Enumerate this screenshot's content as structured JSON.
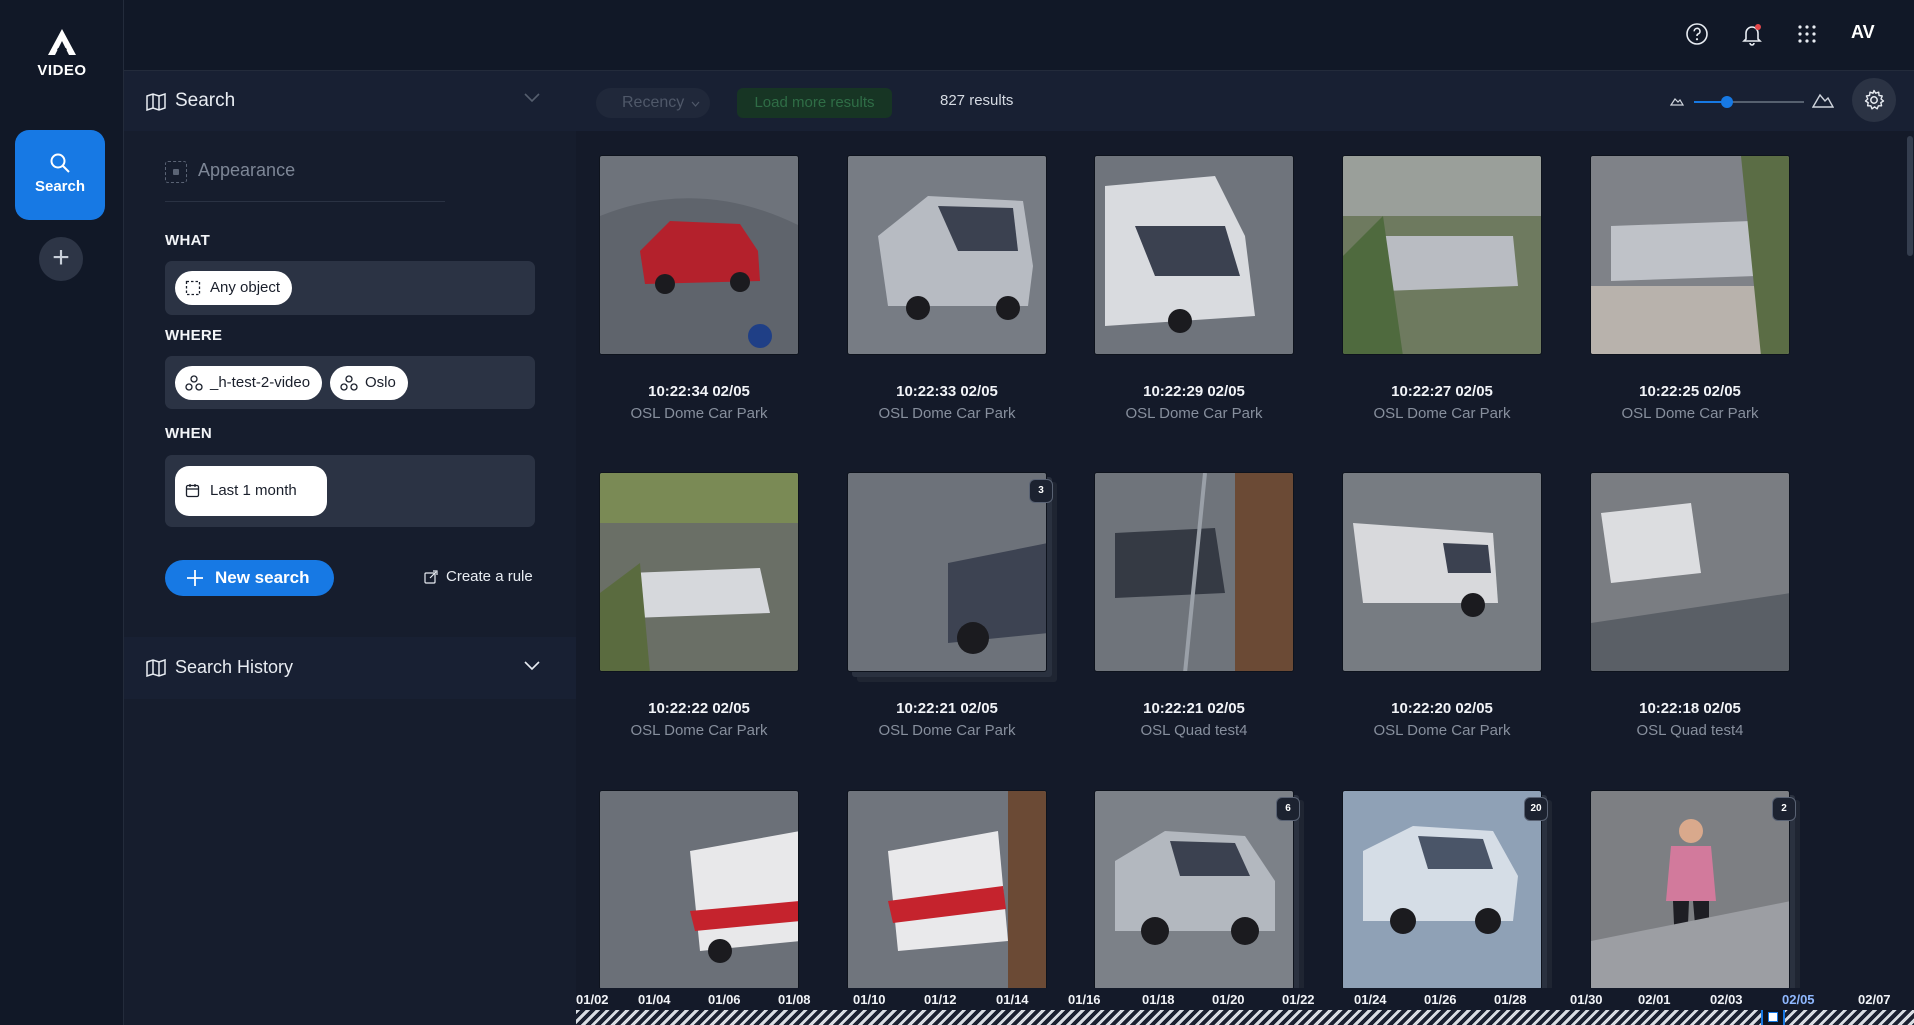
{
  "app": {
    "logo_letter": "A",
    "logo_text": "VIDEO",
    "nav_search_label": "Search",
    "user_initials": "AV"
  },
  "topbar": {
    "icons": [
      "help-icon",
      "bell-icon",
      "apps-grid-icon"
    ],
    "notification_dot_color": "#e2474b"
  },
  "panel": {
    "title": "Search",
    "appearance_label": "Appearance",
    "what_label": "WHAT",
    "what_chip": "Any object",
    "where_label": "WHERE",
    "where_chips": [
      "_h-test-2-video",
      "Oslo"
    ],
    "when_label": "WHEN",
    "when_chip": "Last 1 month",
    "new_search": "New search",
    "create_rule": "Create a rule",
    "history_title": "Search History"
  },
  "toolbar": {
    "sort_label": "Recency",
    "load_more": "Load more results",
    "results_count": "827 results",
    "zoom_level": 0.3
  },
  "colors": {
    "accent": "#1779e4",
    "background": "#141a29",
    "panel": "#161d2d"
  },
  "results": [
    {
      "time": "10:22:34 02/05",
      "camera": "OSL Dome Car Park",
      "badge": "",
      "thumb": "red-car"
    },
    {
      "time": "10:22:33 02/05",
      "camera": "OSL Dome Car Park",
      "badge": "",
      "thumb": "silver-van"
    },
    {
      "time": "10:22:29 02/05",
      "camera": "OSL Dome Car Park",
      "badge": "",
      "thumb": "white-van"
    },
    {
      "time": "10:22:27 02/05",
      "camera": "OSL Dome Car Park",
      "badge": "",
      "thumb": "van-trees"
    },
    {
      "time": "10:22:25 02/05",
      "camera": "OSL Dome Car Park",
      "badge": "",
      "thumb": "van-snow"
    },
    {
      "time": "10:22:22 02/05",
      "camera": "OSL Dome Car Park",
      "badge": "",
      "thumb": "white-van-grass"
    },
    {
      "time": "10:22:21 02/05",
      "camera": "OSL Dome Car Park",
      "badge": "3",
      "thumb": "dark-car-blur"
    },
    {
      "time": "10:22:21 02/05",
      "camera": "OSL Quad test4",
      "badge": "",
      "thumb": "dark-car-pole"
    },
    {
      "time": "10:22:20 02/05",
      "camera": "OSL Dome Car Park",
      "badge": "",
      "thumb": "white-van-road"
    },
    {
      "time": "10:22:18 02/05",
      "camera": "OSL Quad test4",
      "badge": "",
      "thumb": "white-van-turn"
    },
    {
      "time": "",
      "camera": "",
      "badge": "",
      "thumb": "red-truck"
    },
    {
      "time": "",
      "camera": "",
      "badge": "",
      "thumb": "red-truck-pole"
    },
    {
      "time": "",
      "camera": "",
      "badge": "6",
      "thumb": "silver-suv"
    },
    {
      "time": "",
      "camera": "",
      "badge": "20",
      "thumb": "white-suv"
    },
    {
      "time": "",
      "camera": "",
      "badge": "2",
      "thumb": "pedestrian"
    }
  ],
  "timeline": {
    "labels": [
      "01/02",
      "01/04",
      "01/06",
      "01/08",
      "01/10",
      "01/12",
      "01/14",
      "01/16",
      "01/18",
      "01/20",
      "01/22",
      "01/24",
      "01/26",
      "01/28",
      "01/30",
      "02/01",
      "02/03",
      "02/05",
      "02/07"
    ],
    "selected": "02/05"
  }
}
